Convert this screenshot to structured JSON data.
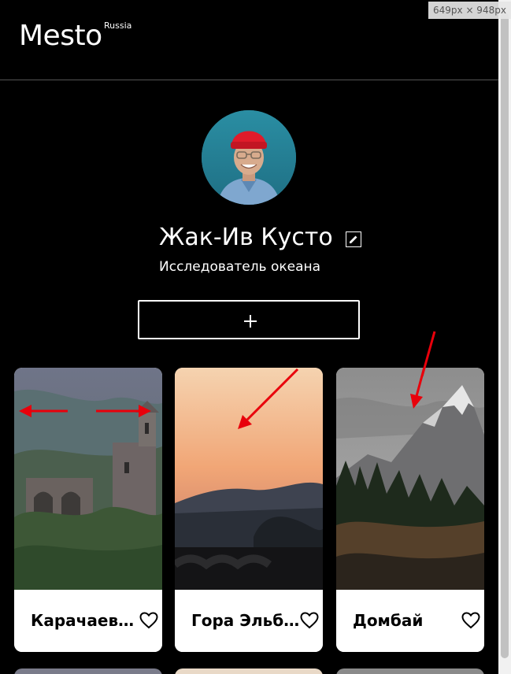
{
  "header": {
    "logo_text": "Mesto",
    "logo_superscript": "Russia"
  },
  "profile": {
    "name": "Жак-Ив Кусто",
    "about": "Исследователь океана",
    "avatar_icon": "avatar-photo",
    "edit_icon": "pencil-icon",
    "add_icon": "plus-icon"
  },
  "cards": [
    {
      "title": "Карачаево-Черкесия",
      "like_icon": "heart-icon"
    },
    {
      "title": "Гора Эльбрус",
      "like_icon": "heart-icon"
    },
    {
      "title": "Домбай",
      "like_icon": "heart-icon"
    }
  ],
  "overlay": {
    "size_label": "649px × 948px"
  },
  "colors": {
    "background": "#000000",
    "card_background": "#ffffff",
    "annotation_arrow": "#e8000b"
  }
}
